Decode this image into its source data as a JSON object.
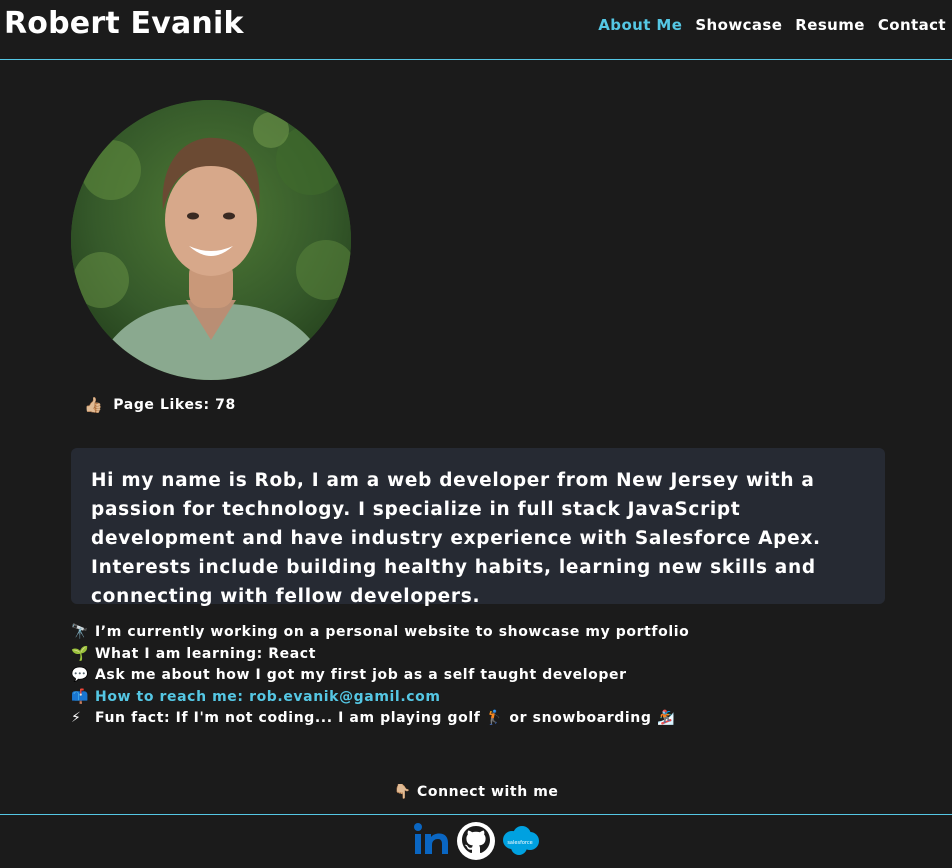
{
  "header": {
    "brand": "Robert Evanik",
    "nav": [
      {
        "label": "About Me",
        "active": true
      },
      {
        "label": "Showcase",
        "active": false
      },
      {
        "label": "Resume",
        "active": false
      },
      {
        "label": "Contact",
        "active": false
      }
    ]
  },
  "profile": {
    "avatar_icon": "profile-photo",
    "likes_icon": "👍🏼",
    "likes_label": "Page Likes: 78"
  },
  "intro": {
    "text": "Hi my name is Rob, I am a web developer from New Jersey with a passion for technology. I specialize in full stack JavaScript development and have industry experience with Salesforce Apex. Interests include building healthy habits, learning new skills and connecting with fellow developers."
  },
  "facts": [
    {
      "emoji": "🔭",
      "text": "I’m currently working on a personal website to showcase my portfolio"
    },
    {
      "emoji": "🌱",
      "text": "What I am learning: React"
    },
    {
      "emoji": "💬",
      "text": "Ask me about how I got my first job as a self taught developer"
    },
    {
      "emoji": "📫",
      "text": "How to reach me: rob.evanik@gamil.com"
    },
    {
      "emoji": "⚡",
      "text": "Fun fact: If I'm not coding... I am playing golf 🏌️ or snowboarding 🏂"
    }
  ],
  "connect": {
    "emoji": "👇🏼",
    "label": "Connect with me"
  },
  "socials": [
    {
      "icon": "linkedin-icon"
    },
    {
      "icon": "github-icon"
    },
    {
      "icon": "salesforce-icon",
      "text": "salesforce"
    }
  ],
  "colors": {
    "background": "#1b1b1b",
    "accent": "#55c7e4",
    "card": "#262a33",
    "linkedin": "#0a66c2",
    "salesforce": "#00a1e0"
  }
}
